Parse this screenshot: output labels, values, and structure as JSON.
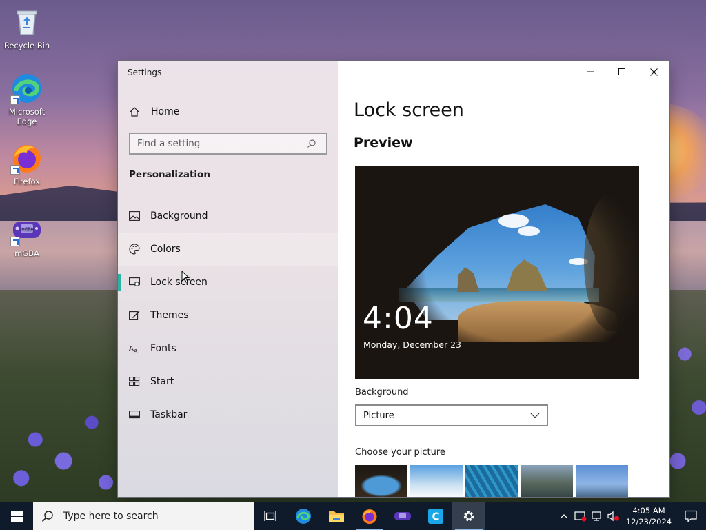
{
  "desktop": {
    "icons": [
      {
        "label": "Recycle Bin"
      },
      {
        "label": "Microsoft Edge"
      },
      {
        "label": "Firefox"
      },
      {
        "label": "mGBA"
      }
    ]
  },
  "window": {
    "title": "Settings",
    "nav": {
      "home_label": "Home",
      "search_placeholder": "Find a setting",
      "section_label": "Personalization",
      "items": [
        {
          "label": "Background",
          "icon": "picture-icon"
        },
        {
          "label": "Colors",
          "icon": "palette-icon"
        },
        {
          "label": "Lock screen",
          "icon": "lock-screen-icon"
        },
        {
          "label": "Themes",
          "icon": "themes-icon"
        },
        {
          "label": "Fonts",
          "icon": "fonts-icon"
        },
        {
          "label": "Start",
          "icon": "start-icon"
        },
        {
          "label": "Taskbar",
          "icon": "taskbar-icon"
        }
      ],
      "selected": "Lock screen"
    },
    "content": {
      "title": "Lock screen",
      "preview_heading": "Preview",
      "preview_time": "4:04",
      "preview_date": "Monday, December 23",
      "background_label": "Background",
      "background_value": "Picture",
      "choose_picture_label": "Choose your picture"
    }
  },
  "taskbar": {
    "search_placeholder": "Type here to search",
    "apps": [
      "task-view",
      "microsoft-edge",
      "file-explorer",
      "firefox",
      "mgba",
      "app-c",
      "settings"
    ],
    "time": "4:05 AM",
    "date": "12/23/2024"
  },
  "colors": {
    "accent": "#2bb2a0",
    "taskbar": "#0f1a2a"
  }
}
